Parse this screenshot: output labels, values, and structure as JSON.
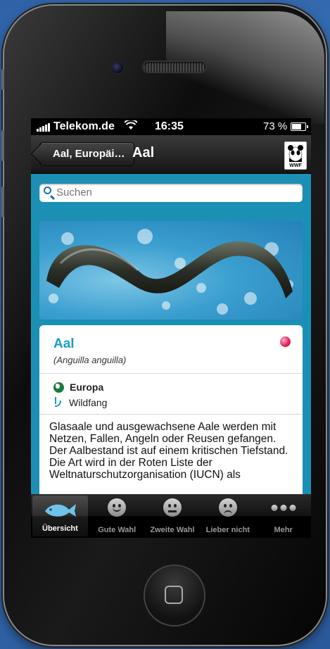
{
  "statusbar": {
    "carrier": "Telekom.de",
    "time": "16:35",
    "battery": "73 %",
    "battery_level": 0.73
  },
  "navbar": {
    "back_label": "Aal, Europäi…",
    "title": "Aal",
    "logo_text": "WWF"
  },
  "search": {
    "placeholder": "Suchen"
  },
  "detail": {
    "name": "Aal",
    "latin": "(Anguilla anguilla)",
    "rating_color": "#e8245c",
    "origin": "Europa",
    "method": "Wildfang",
    "description": "Glasaale und ausgewachsene Aale werden mit Netzen, Fallen, Angeln oder Reusen gefangen. Der Aalbestand ist auf einem kritischen Tiefstand. Die Art wird in der Roten Liste der Weltnaturschutzorganisation (IUCN) als"
  },
  "tabs": [
    {
      "label": "Übersicht",
      "icon": "fish-icon",
      "active": true
    },
    {
      "label": "Gute Wahl",
      "icon": "happy-face-icon",
      "active": false
    },
    {
      "label": "Zweite Wahl",
      "icon": "neutral-face-icon",
      "active": false
    },
    {
      "label": "Lieber nicht",
      "icon": "sad-face-icon",
      "active": false
    },
    {
      "label": "Mehr",
      "icon": "more-dots-icon",
      "active": false
    }
  ],
  "colors": {
    "accent": "#1b9cc2",
    "background": "#1b8fb4"
  }
}
